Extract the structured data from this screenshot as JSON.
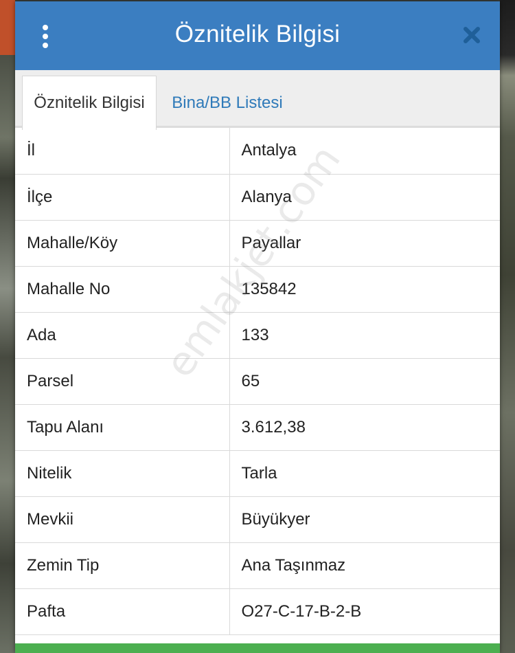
{
  "dialog": {
    "title": "Öznitelik Bilgisi",
    "accent_color": "#3b7ec1",
    "footer_color": "#4caf50"
  },
  "tabs": [
    {
      "label": "Öznitelik Bilgisi",
      "active": true
    },
    {
      "label": "Bina/BB Listesi",
      "active": false
    }
  ],
  "attributes": [
    {
      "key": "İl",
      "value": "Antalya"
    },
    {
      "key": "İlçe",
      "value": "Alanya"
    },
    {
      "key": "Mahalle/Köy",
      "value": "Payallar"
    },
    {
      "key": "Mahalle No",
      "value": "135842"
    },
    {
      "key": "Ada",
      "value": "133"
    },
    {
      "key": "Parsel",
      "value": "65"
    },
    {
      "key": "Tapu Alanı",
      "value": "3.612,38"
    },
    {
      "key": "Nitelik",
      "value": "Tarla"
    },
    {
      "key": "Mevkii",
      "value": "Büyükyer"
    },
    {
      "key": "Zemin Tip",
      "value": "Ana Taşınmaz"
    },
    {
      "key": "Pafta",
      "value": "O27-C-17-B-2-B"
    }
  ],
  "watermark": "emlakjet.com",
  "icons": {
    "menu": "vertical-ellipsis-icon",
    "close": "close-icon"
  }
}
